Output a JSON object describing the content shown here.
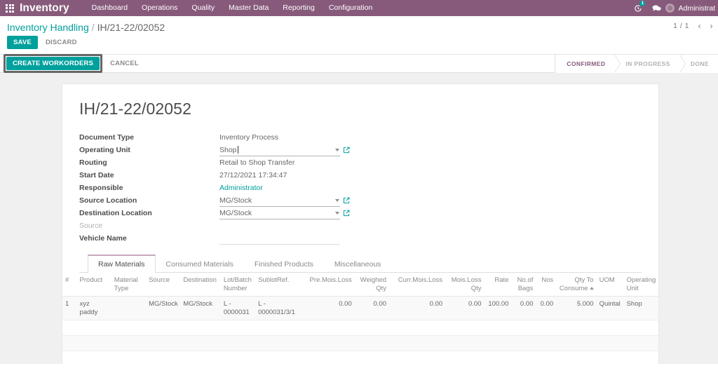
{
  "navbar": {
    "apps_icon": "apps-grid-icon",
    "brand": "Inventory",
    "menu": [
      {
        "label": "Dashboard"
      },
      {
        "label": "Operations"
      },
      {
        "label": "Quality"
      },
      {
        "label": "Master Data"
      },
      {
        "label": "Reporting"
      },
      {
        "label": "Configuration"
      }
    ],
    "activity_badge": "1",
    "activity_icon": "clock-activity-icon",
    "messages_icon": "chat-bubble-icon",
    "user_name": "Administrat",
    "brand_color": "#875A7B",
    "accent_color": "#00A09D"
  },
  "control_panel": {
    "breadcrumb_root": "Inventory Handling",
    "breadcrumb_sep": "/",
    "breadcrumb_current": "IH/21-22/02052",
    "save_label": "SAVE",
    "discard_label": "DISCARD",
    "pager_value": "1 / 1",
    "pager_prev": "‹",
    "pager_next": "›"
  },
  "action_bar": {
    "create_workorders_label": "CREATE WORKORDERS",
    "cancel_label": "CANCEL",
    "statuses": [
      {
        "label": "CONFIRMED",
        "active": true
      },
      {
        "label": "IN PROGRESS",
        "active": false
      },
      {
        "label": "DONE",
        "active": false
      }
    ]
  },
  "form": {
    "record_title": "IH/21-22/02052",
    "fields": [
      {
        "label": "Document Type",
        "value": "Inventory Process",
        "type": "readonly"
      },
      {
        "label": "Operating Unit",
        "value": "Shop",
        "type": "many2one_focus"
      },
      {
        "label": "Routing",
        "value": "Retail to Shop Transfer",
        "type": "readonly"
      },
      {
        "label": "Start Date",
        "value": "27/12/2021 17:34:47",
        "type": "readonly"
      },
      {
        "label": "Responsible",
        "value": "Administrator",
        "type": "link"
      },
      {
        "label": "Source Location",
        "value": "MG/Stock",
        "type": "many2one"
      },
      {
        "label": "Destination Location",
        "value": "MG/Stock",
        "type": "many2one"
      },
      {
        "label": "Source",
        "value": "",
        "type": "muted"
      },
      {
        "label": "Vehicle Name",
        "value": "",
        "type": "text"
      }
    ]
  },
  "notebook": {
    "tabs": [
      {
        "label": "Raw Materials",
        "active": true
      },
      {
        "label": "Consumed Materials",
        "active": false
      },
      {
        "label": "Finished Products",
        "active": false
      },
      {
        "label": "Miscellaneous",
        "active": false
      }
    ]
  },
  "lines_table": {
    "columns": [
      {
        "label": "#",
        "align": "left"
      },
      {
        "label": "Product",
        "align": "left"
      },
      {
        "label": "Material Type",
        "align": "left"
      },
      {
        "label": "Source",
        "align": "left"
      },
      {
        "label": "Destination",
        "align": "left"
      },
      {
        "label": "Lot/Batch Number",
        "align": "left"
      },
      {
        "label": "SublotRef.",
        "align": "left"
      },
      {
        "label": "Pre.Mois.Loss",
        "align": "right"
      },
      {
        "label": "Weighed Qty",
        "align": "right"
      },
      {
        "label": "Curr.Mois.Loss",
        "align": "right"
      },
      {
        "label": "Mois.Loss Qty",
        "align": "right"
      },
      {
        "label": "Rate",
        "align": "right"
      },
      {
        "label": "No.of Bags",
        "align": "right"
      },
      {
        "label": "Nos",
        "align": "right"
      },
      {
        "label": "Qty To Consume",
        "align": "right",
        "sorted": "asc"
      },
      {
        "label": "UOM",
        "align": "left"
      },
      {
        "label": "Operating Unit",
        "align": "left"
      }
    ],
    "rows": [
      {
        "index": "1",
        "product": "xyz paddy",
        "material_type": "",
        "source": "MG/Stock",
        "destination": "MG/Stock",
        "lot_batch_number": "L - 0000031",
        "sublot_ref": "L - 0000031/3/1",
        "pre_mois_loss": "0.00",
        "weighed_qty": "0.00",
        "curr_mois_loss": "0.00",
        "mois_loss_qty": "0.00",
        "rate": "100.00",
        "no_of_bags": "0.00",
        "nos": "0.00",
        "qty_to_consume": "5.000",
        "uom": "Quintal",
        "operating_unit": "Shop"
      }
    ],
    "empty_rows": 3
  }
}
